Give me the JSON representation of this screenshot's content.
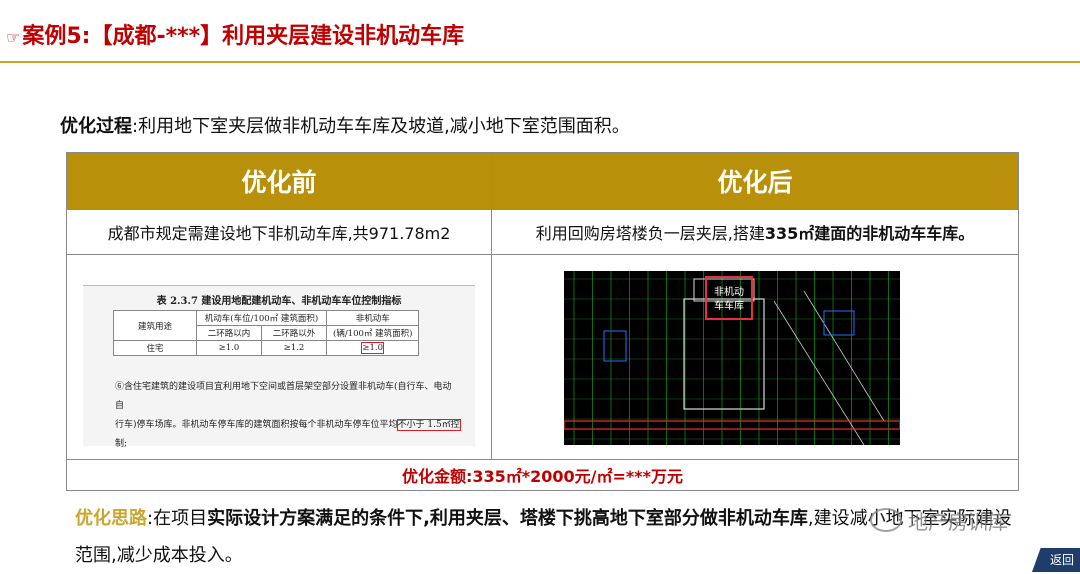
{
  "header": {
    "icon": "pointing-hand-icon",
    "title": "案例5:【成都-***】利用夹层建设非机动车库"
  },
  "process": {
    "label": "优化过程",
    "text": ":利用地下室夹层做非机动车车库及坡道,减小地下室范围面积。"
  },
  "compare": {
    "before": {
      "heading": "优化前",
      "text": "成都市规定需建设地下非机动车库,共971.78m2"
    },
    "after": {
      "heading": "优化后",
      "text_prefix": "利用回购房塔楼负一层夹层,搭建",
      "text_bold": "335㎡建面的非机动车车库。"
    },
    "saving": "优化金额:335㎡*2000元/㎡=***万元"
  },
  "spec_image": {
    "caption": "表 2.3.7   建设用地配建机动车、非机动车车位控制指标",
    "col_use": "建筑用途",
    "col_motor": "机动车(车位/100㎡ 建筑面积)",
    "col_nonmotor": "非机动车",
    "col_nonmotor_unit": "(辆/100㎡ 建筑面积)",
    "sub_inner": "二环路以内",
    "sub_outer": "二环路以外",
    "row_use": "住宅",
    "row_inner": "≥1.0",
    "row_outer": "≥1.2",
    "row_nonmotor": "≥1.0",
    "note_a": "⑥含住宅建筑的建设项目宜利用地下空间或首层架空部分设置非机动车(自行车、电动自",
    "note_b": "行车)停车场库。非机动车停车库的建筑面积按每个非机动车停车位平均",
    "note_mark": "不小于 1.5㎡控",
    "note_c": "制;"
  },
  "cad_image": {
    "label_line1": "非机动",
    "label_line2": "车车库",
    "grid_color": "#18c41e",
    "mark_color": "#e8303a",
    "accent": "#2a6cff"
  },
  "idea": {
    "label": "优化思路",
    "pre": ":在项目",
    "bold": "实际设计方案满足的条件下,利用夹层、塔楼下挑高地下室部分做非机动车库",
    "post": ",建设减小地下室实际建设范围,减少成本投入。"
  },
  "watermark": "地产房训库",
  "nav": {
    "back": "返回"
  },
  "colors": {
    "title_red": "#c00000",
    "gold": "#b8900a",
    "label_gold": "#c9a72c"
  }
}
